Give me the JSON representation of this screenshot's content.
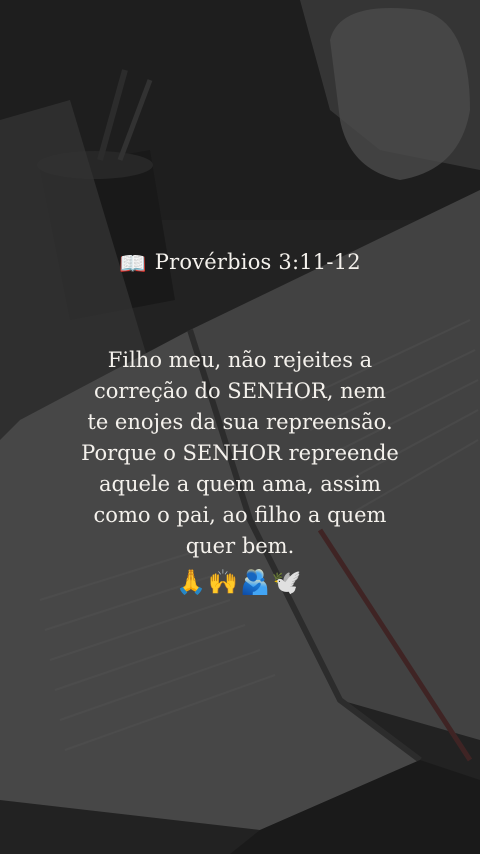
{
  "story": {
    "reference": "Provérbios 3:11-12",
    "book_icon": "open-book-icon",
    "verse": "Filho meu, não rejeites a\ncorreção do SENHOR, nem\nte enojes da sua repreensão.\nPorque o SENHOR repreende\naquele a quem ama, assim\ncomo o pai, ao filho a quem\nquer bem.",
    "emojis": "🙏🙌🫂🕊️"
  },
  "colors": {
    "text": "#f4f1ec",
    "background": "#262626"
  }
}
